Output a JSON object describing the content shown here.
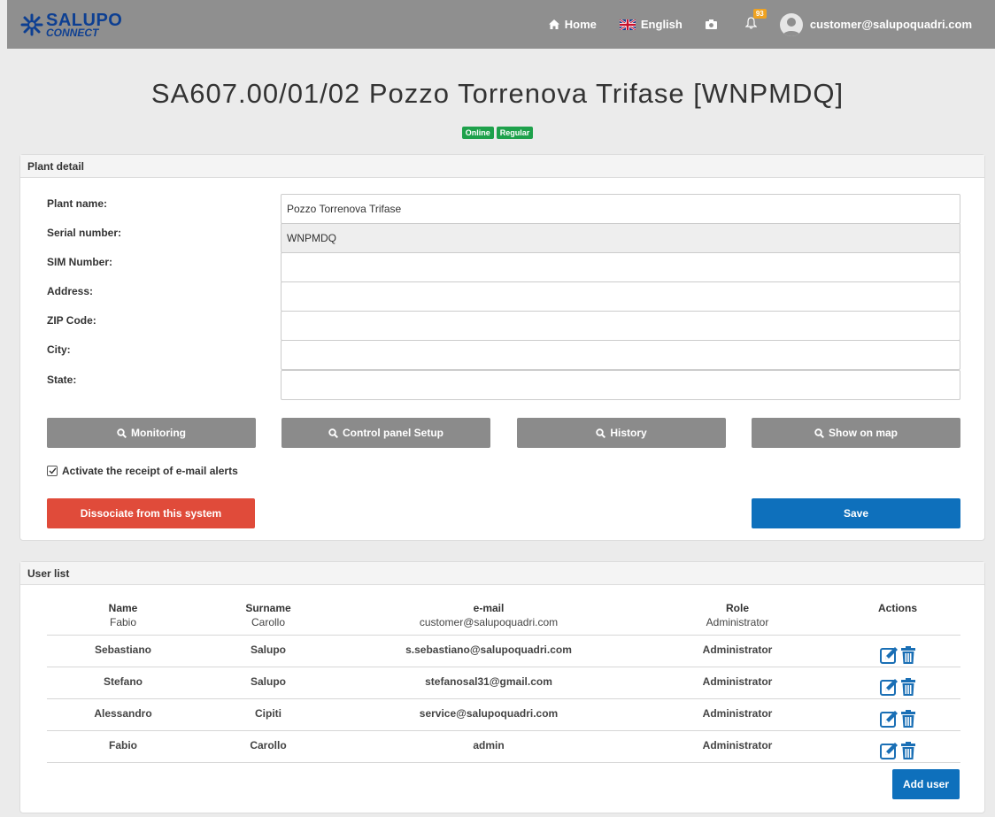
{
  "nav": {
    "brand_main": "SALUPO",
    "brand_sub": "CONNECT",
    "home": "Home",
    "language": "English",
    "notifications_count": "93",
    "user_email": "customer@salupoquadri.com"
  },
  "page": {
    "title": "SA607.00/01/02 Pozzo Torrenova Trifase [WNPMDQ]",
    "status_online": "Online",
    "status_regular": "Regular"
  },
  "detail": {
    "header": "Plant detail",
    "fields": [
      {
        "label": "Plant name:",
        "value": ""
      },
      {
        "label": "Serial number:",
        "value": ""
      },
      {
        "label": "SIM Number:",
        "value": ""
      },
      {
        "label": "Address:",
        "value": ""
      },
      {
        "label": "ZIP Code:",
        "value": ""
      },
      {
        "label": "City:",
        "value": ""
      },
      {
        "label": "State:",
        "value": ""
      }
    ],
    "values": {
      "plant_name": "Pozzo Torrenova Trifase",
      "serial_number": "WNPMDQ"
    },
    "buttons": {
      "monitoring": "Monitoring",
      "control_panel": "Control panel Setup",
      "history": "History",
      "show_on_map": "Show on map",
      "dissociate": "Dissociate from this system",
      "save": "Save"
    },
    "email_alerts_label": "Activate the receipt of e-mail alerts",
    "email_alerts_checked": true
  },
  "users": {
    "header": "User list",
    "columns": {
      "name": "Name",
      "surname": "Surname",
      "email": "e-mail",
      "role": "Role",
      "actions": "Actions"
    },
    "first": {
      "name": "Fabio",
      "surname": "Carollo",
      "email": "customer@salupoquadri.com",
      "role": "Administrator"
    },
    "rows": [
      {
        "name": "Sebastiano",
        "surname": "Salupo",
        "email": "s.sebastiano@salupoquadri.com",
        "role": "Administrator"
      },
      {
        "name": "Stefano",
        "surname": "Salupo",
        "email": "stefanosal31@gmail.com",
        "role": "Administrator"
      },
      {
        "name": "Alessandro",
        "surname": "Cipiti",
        "email": "service@salupoquadri.com",
        "role": "Administrator"
      },
      {
        "name": "Fabio",
        "surname": "Carollo",
        "email": "admin",
        "role": "Administrator"
      }
    ],
    "add_user": "Add user"
  },
  "colors": {
    "navbar": "#8f8f8f",
    "brand": "#0d3f92",
    "status_green": "#1ea14b",
    "button_grey": "#8b8b8b",
    "button_red": "#e04b3a",
    "button_blue": "#0e70bc",
    "action_blue": "#1a6fb5",
    "badge_orange": "#f0a321"
  },
  "icons": {
    "home": "home-icon",
    "flag": "uk-flag-icon",
    "camera": "camera-icon",
    "bell": "bell-icon",
    "avatar": "user-avatar-icon",
    "search": "search-icon",
    "checkbox": "checkbox-checked-icon",
    "edit": "edit-icon",
    "delete": "trash-icon"
  }
}
